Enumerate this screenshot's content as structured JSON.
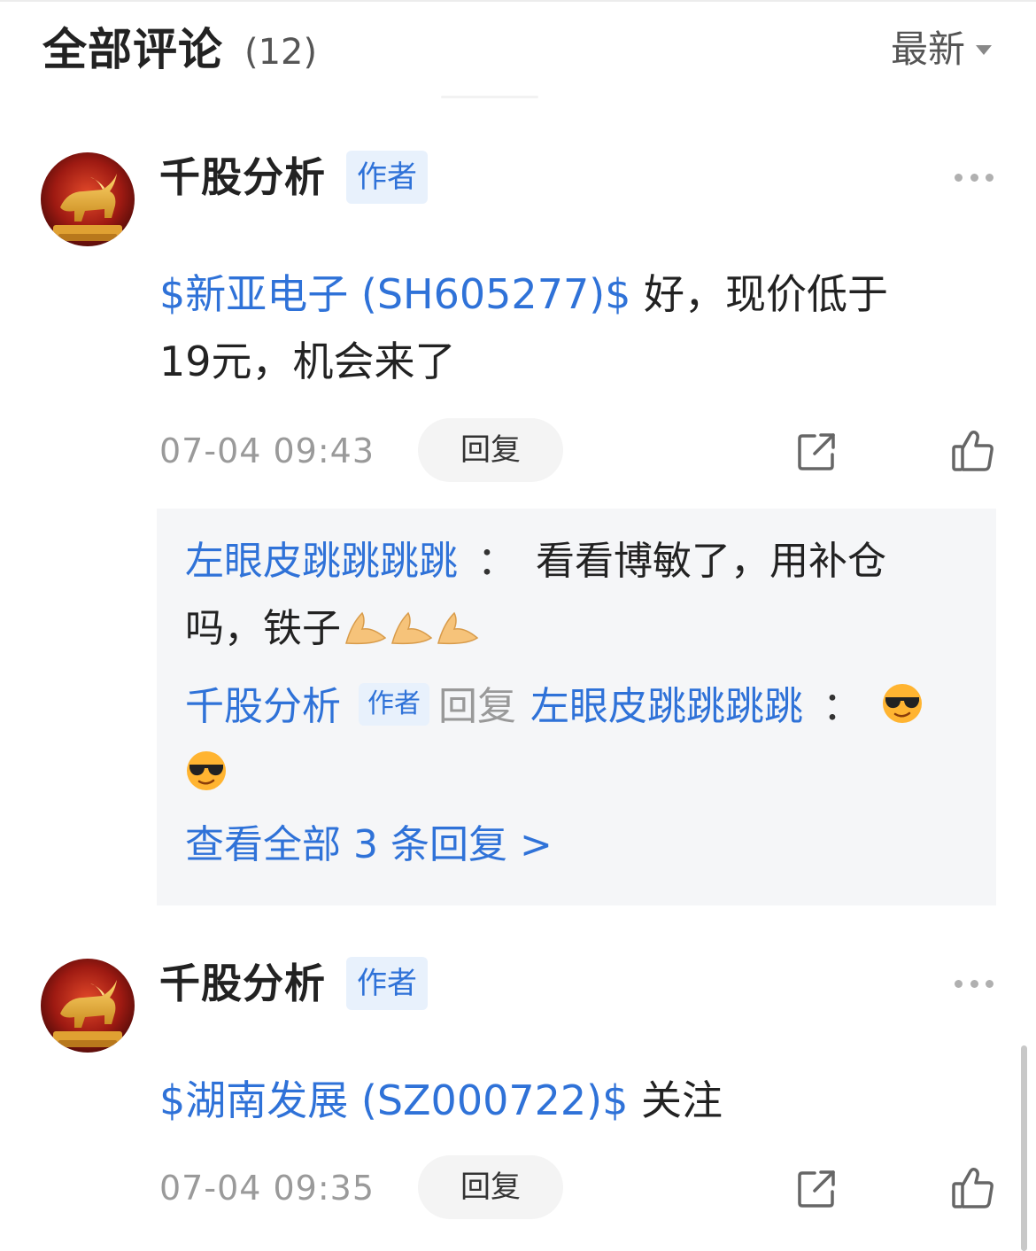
{
  "header": {
    "title": "全部评论",
    "count": "(12)",
    "sort_label": "最新"
  },
  "comments": [
    {
      "author": "千股分析",
      "badge": "作者",
      "stock_link": "$新亚电子 (SH605277)$",
      "text_line1": " 好，现价低于",
      "text_line2": "19元，机会来了",
      "time": "07-04 09:43",
      "reply_label": "回复",
      "replies": [
        {
          "user": "左眼皮跳跳跳跳",
          "colon": "：",
          "text_line1": "看看博敏了，用补仓",
          "text_line2": "吗，铁子"
        },
        {
          "user": "千股分析",
          "badge": "作者",
          "reply_word": "回复",
          "target": "左眼皮跳跳跳跳",
          "colon": "："
        }
      ],
      "view_all": "查看全部 3 条回复 >"
    },
    {
      "author": "千股分析",
      "badge": "作者",
      "stock_link": "$湖南发展 (SZ000722)$",
      "text_line1": " 关注",
      "time": "07-04 09:35",
      "reply_label": "回复"
    }
  ],
  "icons": {
    "more": "more-dots-icon",
    "share": "share-icon",
    "like": "thumbs-up-icon",
    "sort": "caret-down-icon",
    "emoji_pray": "pray-hands-emoji",
    "emoji_cool": "sunglasses-emoji"
  },
  "colors": {
    "link": "#2f72d8",
    "badge_bg": "#e8f1fc",
    "reply_bg": "#f5f6f8",
    "muted": "#9a9a9a"
  }
}
